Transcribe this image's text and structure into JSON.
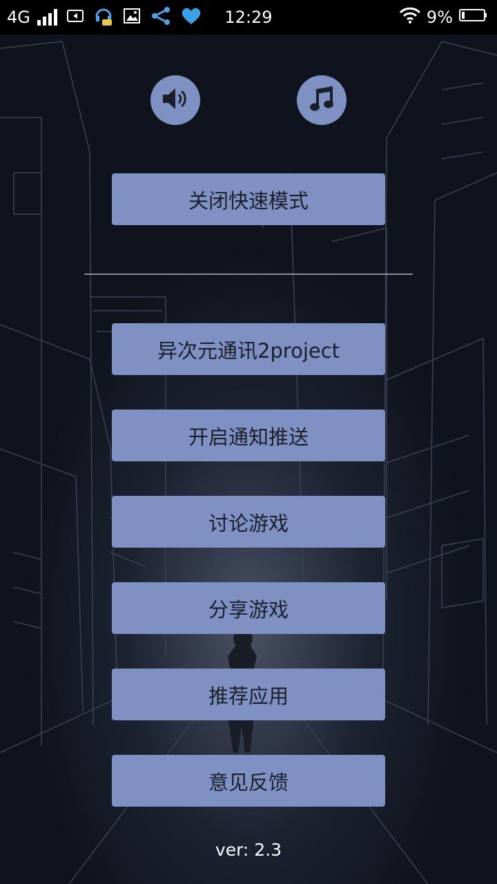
{
  "status_bar": {
    "network": "4G",
    "time": "12:29",
    "battery_percent": "9%",
    "icons": [
      "signal-icon",
      "sim-icon",
      "headset-chat-icon",
      "image-icon",
      "share-icon",
      "heart-icon",
      "wifi-icon",
      "battery-icon"
    ]
  },
  "controls": {
    "sound_icon": "speaker-icon",
    "music_icon": "music-note-icon"
  },
  "menu": {
    "fast_mode": "关闭快速模式",
    "items": [
      "异次元通讯2project",
      "开启通知推送",
      "讨论游戏",
      "分享游戏",
      "推荐应用",
      "意见反馈"
    ]
  },
  "footer": {
    "version": "ver: 2.3"
  },
  "colors": {
    "button": "#7f91c2",
    "background": "#0f131d",
    "button_text": "#1b1f2b"
  }
}
